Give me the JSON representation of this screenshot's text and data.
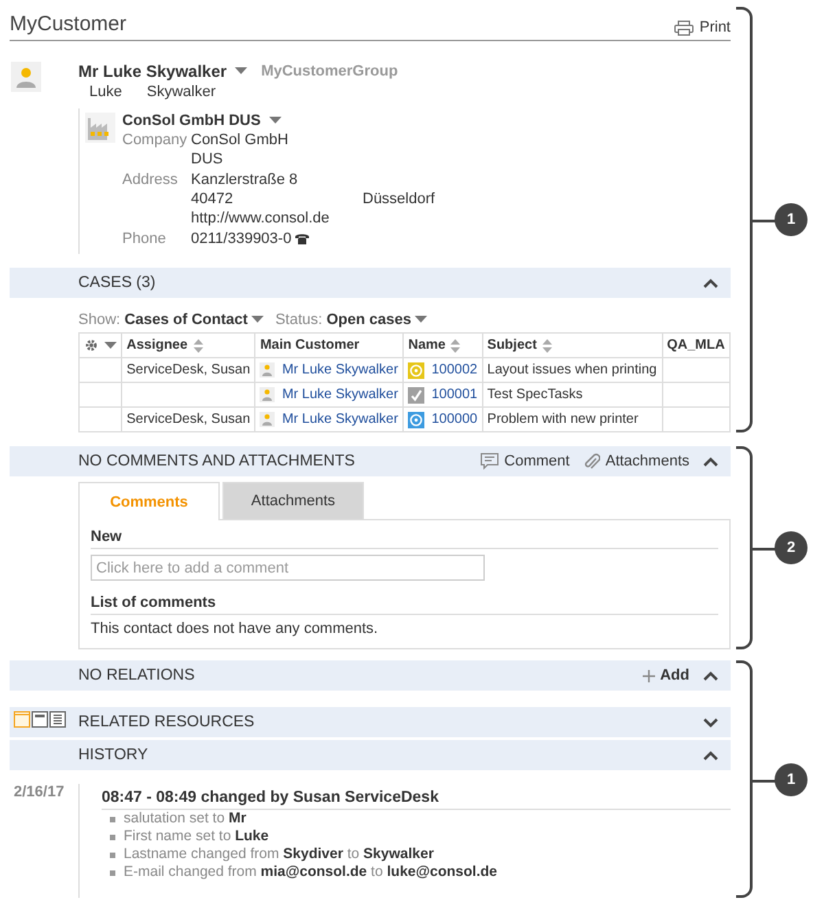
{
  "header": {
    "title": "MyCustomer",
    "print_label": "Print"
  },
  "contact": {
    "name": "Mr Luke Skywalker",
    "group": "MyCustomerGroup",
    "first_name": "Luke",
    "last_name": "Skywalker",
    "company": {
      "name": "ConSol GmbH DUS",
      "fields": [
        {
          "label": "Company",
          "kind": "text",
          "lines": [
            [
              "ConSol GmbH"
            ],
            [
              "DUS"
            ]
          ]
        },
        {
          "label": "Address",
          "kind": "text",
          "lines": [
            [
              "Kanzlerstraße 8"
            ],
            [
              "40472",
              "Düsseldorf"
            ],
            [
              "http://www.consol.de"
            ]
          ]
        },
        {
          "label": "Phone",
          "kind": "phone",
          "lines": [
            [
              "0211/339903-0"
            ]
          ]
        }
      ]
    }
  },
  "cases": {
    "title": "CASES (3)",
    "expanded": true,
    "filters": [
      {
        "label": "Show:",
        "value": "Cases of Contact"
      },
      {
        "label": "Status:",
        "value": "Open cases"
      }
    ],
    "table": {
      "columns": [
        {
          "kind": "settings",
          "sortable": false
        },
        {
          "label": "Assignee",
          "kind": "text",
          "sortable": true
        },
        {
          "label": "Main Customer",
          "kind": "text",
          "sortable": false
        },
        {
          "label": "Name",
          "kind": "text",
          "sortable": true
        },
        {
          "label": "Subject",
          "kind": "text",
          "sortable": true
        },
        {
          "label": "QA_MLA",
          "kind": "text",
          "sortable": false
        }
      ],
      "rows": [
        {
          "assignee": "ServiceDesk, Susan",
          "main_customer": "Mr Luke Skywalker",
          "kind": "target",
          "color": "#e6c619",
          "name": "100002",
          "subject": "Layout issues when printing"
        },
        {
          "main_customer": "Mr Luke Skywalker",
          "kind": "check",
          "color": "#a0a0a0",
          "name": "100001",
          "subject": "Test SpecTasks"
        },
        {
          "assignee": "ServiceDesk, Susan",
          "main_customer": "Mr Luke Skywalker",
          "kind": "target",
          "color": "#3d9be0",
          "name": "100000",
          "subject": "Problem with new printer"
        }
      ]
    }
  },
  "comments": {
    "title": "NO COMMENTS AND ATTACHMENTS",
    "expanded": true,
    "actions": [
      {
        "label": "Comment",
        "kind": "comment"
      },
      {
        "label": "Attachments",
        "kind": "attach"
      }
    ],
    "tabs": [
      {
        "label": "Comments",
        "selected": true
      },
      {
        "label": "Attachments",
        "selected": false
      }
    ],
    "new_label": "New",
    "placeholder": "Click here to add a comment",
    "list_label": "List of comments",
    "empty_text": "This contact does not have any comments."
  },
  "relations": {
    "title": "NO RELATIONS",
    "add_label": "Add",
    "expanded": true
  },
  "resources": {
    "title": "RELATED RESOURCES",
    "expanded": false,
    "views": [
      {
        "kind": "panel",
        "selected": true
      },
      {
        "kind": "header",
        "selected": false
      },
      {
        "kind": "list",
        "selected": false
      }
    ]
  },
  "history": {
    "title": "HISTORY",
    "expanded": true,
    "entries": [
      {
        "date": "2/16/17",
        "title": "08:47 - 08:49 changed by Susan ServiceDesk",
        "changes": [
          "salutation set to **Mr**",
          "First name set to **Luke**",
          "Lastname changed from **Skydiver** to **Skywalker**",
          "E-mail changed from **mia@consol.de** to **luke@consol.de**"
        ]
      }
    ]
  },
  "callouts": [
    {
      "number": "1"
    },
    {
      "number": "2"
    },
    {
      "number": "1"
    }
  ]
}
